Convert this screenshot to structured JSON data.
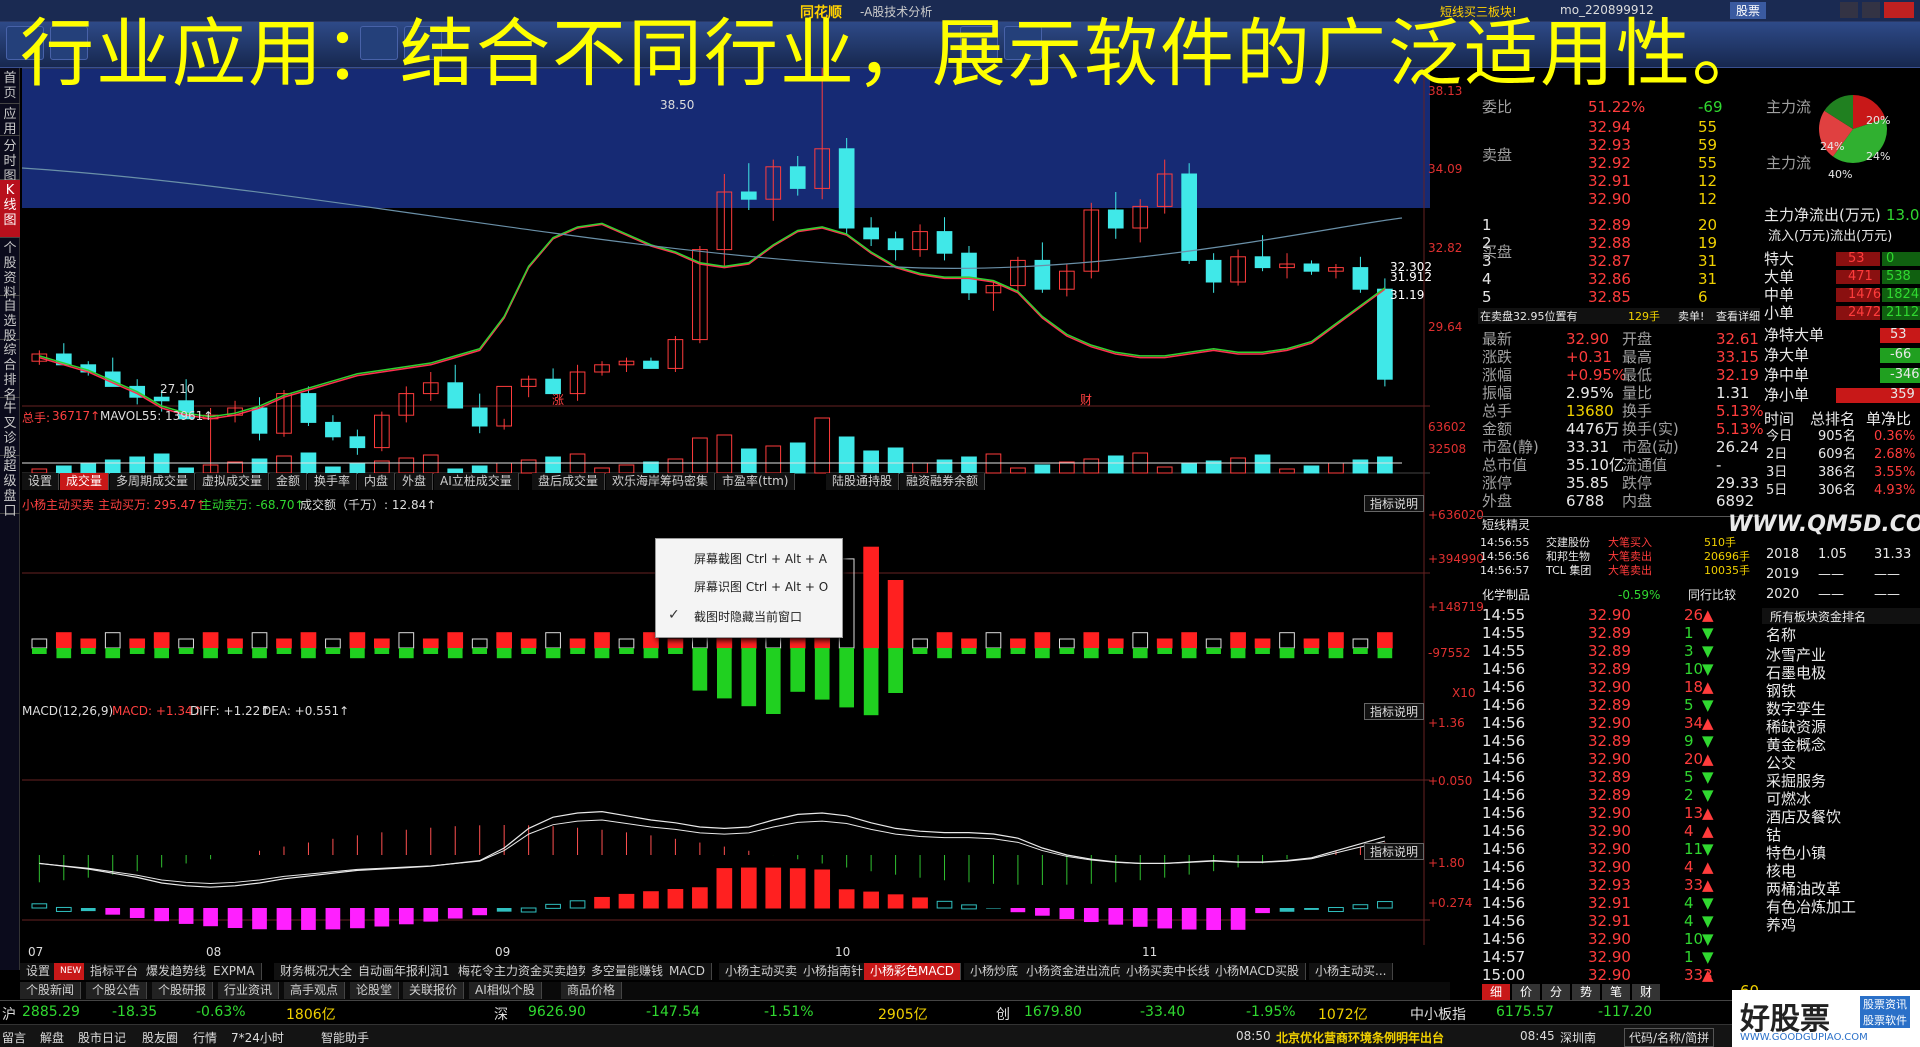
{
  "overlay": {
    "title": "行业应用：结合不同行业，展示软件的广泛适用性。"
  },
  "app": {
    "name": "同花顺",
    "subtitle": "-A股技术分析",
    "account": "mo_220899912",
    "promo": "短线买三板块!",
    "search": "股票"
  },
  "left_tabs": [
    {
      "label": "首页"
    },
    {
      "label": "应用"
    },
    {
      "label": "分时图"
    },
    {
      "label": "K线图"
    },
    {
      "label": "个股资料"
    },
    {
      "label": "自选股"
    },
    {
      "label": "综合排名"
    },
    {
      "label": "牛叉诊股"
    },
    {
      "label": "超级盘口"
    }
  ],
  "chart_data": [
    {
      "type": "candlestick",
      "title": "",
      "price_axis": {
        "ticks": [
          38.13,
          34.09,
          32.82,
          29.64
        ]
      },
      "ma_labels": [
        "32.302",
        "31.912",
        "31.19"
      ],
      "annotations": [
        "38.50",
        "27.10"
      ],
      "x_labels": [
        "07",
        "08",
        "09",
        "10",
        "11"
      ],
      "events": [
        "涨",
        "财"
      ],
      "series": [
        {
          "name": "MA",
          "values": [
            30.4,
            30.2,
            30.0,
            29.7,
            29.4,
            29.0,
            28.8,
            28.7,
            28.8,
            29.0,
            29.3,
            29.5,
            29.7,
            29.9,
            30.0,
            30.1,
            30.2,
            30.4,
            30.6,
            31.5,
            32.9,
            33.7,
            34.0,
            34.1,
            33.8,
            33.5,
            33.3,
            33.0,
            32.9,
            33.0,
            33.5,
            33.9,
            34.0,
            33.8,
            33.3,
            32.9,
            32.7,
            32.6,
            32.6,
            32.5,
            32.2,
            31.5,
            31.0,
            30.7,
            30.5,
            30.4,
            30.4,
            30.5,
            30.6,
            30.5,
            30.5,
            30.6,
            30.8,
            31.3,
            31.8,
            32.3
          ]
        }
      ],
      "candles": [
        [
          30.3,
          30.6,
          30.2,
          30.5
        ],
        [
          30.5,
          30.8,
          30.3,
          30.2
        ],
        [
          30.2,
          30.3,
          29.9,
          30.0
        ],
        [
          30.0,
          30.4,
          29.8,
          29.6
        ],
        [
          29.6,
          29.8,
          29.1,
          29.3
        ],
        [
          29.3,
          29.5,
          28.9,
          29.2
        ],
        [
          29.2,
          29.8,
          29.0,
          28.7
        ],
        [
          28.7,
          29.0,
          27.1,
          28.8
        ],
        [
          28.8,
          29.2,
          28.6,
          29.0
        ],
        [
          29.0,
          29.3,
          28.1,
          28.3
        ],
        [
          28.3,
          29.5,
          28.2,
          29.4
        ],
        [
          29.4,
          29.6,
          28.5,
          28.6
        ],
        [
          28.6,
          28.8,
          28.1,
          28.2
        ],
        [
          28.2,
          28.4,
          27.7,
          27.9
        ],
        [
          27.9,
          28.9,
          27.8,
          28.8
        ],
        [
          28.8,
          29.6,
          28.6,
          29.4
        ],
        [
          29.4,
          30.0,
          29.2,
          29.7
        ],
        [
          29.7,
          30.2,
          29.5,
          29.0
        ],
        [
          29.0,
          29.4,
          28.3,
          28.5
        ],
        [
          28.5,
          28.7,
          28.4,
          29.6
        ],
        [
          29.6,
          29.9,
          29.3,
          29.8
        ],
        [
          29.8,
          30.1,
          29.5,
          29.4
        ],
        [
          29.4,
          30.2,
          29.2,
          30.0
        ],
        [
          30.0,
          30.3,
          29.9,
          30.2
        ],
        [
          30.2,
          30.4,
          30.0,
          30.3
        ],
        [
          30.3,
          30.4,
          30.1,
          30.1
        ],
        [
          30.1,
          31.0,
          30.0,
          30.9
        ],
        [
          30.9,
          33.5,
          30.8,
          33.4
        ],
        [
          33.4,
          35.5,
          32.9,
          35.0
        ],
        [
          35.0,
          35.8,
          34.5,
          34.8
        ],
        [
          34.8,
          35.9,
          34.2,
          35.7
        ],
        [
          35.7,
          36.0,
          34.9,
          35.1
        ],
        [
          35.1,
          38.5,
          34.8,
          36.2
        ],
        [
          36.2,
          36.5,
          33.8,
          34.0
        ],
        [
          34.0,
          34.3,
          33.5,
          33.7
        ],
        [
          33.7,
          33.9,
          33.1,
          33.4
        ],
        [
          33.4,
          34.1,
          33.2,
          33.9
        ],
        [
          33.9,
          34.3,
          33.1,
          33.3
        ],
        [
          33.3,
          33.5,
          32.0,
          32.2
        ],
        [
          32.2,
          32.5,
          31.7,
          32.4
        ],
        [
          32.4,
          33.2,
          32.2,
          33.1
        ],
        [
          33.1,
          33.6,
          32.2,
          32.3
        ],
        [
          32.3,
          33.0,
          32.1,
          32.8
        ],
        [
          32.8,
          34.7,
          32.6,
          34.5
        ],
        [
          34.5,
          35.0,
          33.7,
          34.0
        ],
        [
          34.0,
          34.8,
          33.6,
          34.6
        ],
        [
          34.6,
          35.9,
          34.4,
          35.5
        ],
        [
          35.5,
          35.8,
          33.0,
          33.1
        ],
        [
          33.1,
          33.3,
          32.2,
          32.5
        ],
        [
          32.5,
          33.4,
          32.4,
          33.2
        ],
        [
          33.2,
          33.8,
          32.8,
          32.9
        ],
        [
          32.9,
          33.3,
          32.6,
          33.0
        ],
        [
          33.0,
          33.1,
          32.7,
          32.8
        ],
        [
          32.8,
          33.0,
          32.6,
          32.9
        ],
        [
          32.9,
          33.2,
          32.2,
          32.3
        ],
        [
          32.3,
          32.6,
          29.6,
          29.8
        ]
      ]
    },
    {
      "type": "bar",
      "title": "",
      "series": [
        {
          "name": "",
          "values": []
        }
      ]
    },
    {
      "type": "bar",
      "title": "",
      "price_axis": {
        "ticks": [
          "+636020",
          "+394990",
          "+148719",
          "-97552"
        ]
      },
      "scale": "X10"
    },
    {
      "type": "line",
      "title": "MACD(12,26,9)",
      "price_axis": {
        "ticks": [
          "+1.36",
          "+0.050"
        ]
      }
    },
    {
      "type": "bar",
      "title": "",
      "price_axis": {
        "ticks": [
          "+1.80",
          "+0.274"
        ]
      }
    }
  ],
  "vol": {
    "label": "总手:",
    "value": "36717↑",
    "ma": "MAVOL55: 13961↑",
    "ticks": [
      "63602",
      "32508"
    ]
  },
  "tabs1": [
    "设置",
    "成交量",
    "多周期成交量",
    "虚拟成交量",
    "金额",
    "换手率",
    "内盘",
    "外盘",
    "AI立桩成交量",
    "盘后成交量",
    "欢乐海岸筹码密集",
    "市盈率(ttm)",
    "陆股通持股",
    "融资融券余额"
  ],
  "ind1": {
    "a": "小杨主动买卖",
    "b": "主动买万: 295.47↑",
    "c": "主动卖万: -68.70↑",
    "d": "成交额（千万）: 12.84↑",
    "btn": "指标说明"
  },
  "macd": {
    "a": "MACD(12,26,9)",
    "b": "MACD: +1.34↑",
    "c": "DIFF: +1.22↑",
    "d": "DEA: +0.551↑",
    "btn": "指标说明"
  },
  "ind3": {
    "btn": "指标说明"
  },
  "menu": [
    {
      "label": "屏幕截图  Ctrl + Alt + A",
      "checked": false
    },
    {
      "label": "屏幕识图  Ctrl + Alt + O",
      "checked": false
    },
    {
      "label": "截图时隐藏当前窗口",
      "checked": true
    }
  ],
  "tabs2": [
    "设置",
    "NEW",
    "指标平台",
    "爆发趋势线",
    "EXPMA",
    "财务概况大全",
    "自动画年报利润1",
    "梅花令主力资金买卖趋势",
    "多空量能赚钱",
    "MACD",
    "小杨主动买卖",
    "小杨指南针",
    "小杨彩色MACD",
    "小杨炒底",
    "小杨资金进出流向",
    "小杨买卖中长线",
    "小杨MACD买股",
    "小杨主动买..."
  ],
  "navtabs": [
    "个股新闻",
    "个股公告",
    "个股研报",
    "行业资讯",
    "高手观点",
    "论股堂",
    "关联报价",
    "AI相似个股",
    "商品价格"
  ],
  "orderbook": {
    "header": "委比",
    "header_val": "51.22%",
    "header_n": "-69",
    "sell": [
      {
        "p": "32.94",
        "v": "55"
      },
      {
        "p": "32.93",
        "v": "59"
      },
      {
        "p": "32.92",
        "v": "55"
      },
      {
        "p": "32.91",
        "v": "12"
      },
      {
        "p": "32.90",
        "v": "12"
      }
    ],
    "buy": [
      {
        "i": "1",
        "p": "32.89",
        "v": "20"
      },
      {
        "i": "2",
        "p": "32.88",
        "v": "19"
      },
      {
        "i": "3",
        "p": "32.87",
        "v": "31"
      },
      {
        "i": "4",
        "p": "32.86",
        "v": "31"
      },
      {
        "i": "5",
        "p": "32.85",
        "v": "6"
      }
    ],
    "sell_lbl": "卖盘",
    "buy_lbl": "买盘"
  },
  "pending": {
    "a": "在卖盘32.95位置有",
    "b": "129手",
    "c": "卖单!",
    "d": "查看详细"
  },
  "quote": [
    [
      "最新",
      "32.90",
      "开盘",
      "32.61"
    ],
    [
      "涨跌",
      "+0.31",
      "最高",
      "33.15"
    ],
    [
      "涨幅",
      "+0.95%",
      "最低",
      "32.19"
    ],
    [
      "振幅",
      "2.95%",
      "量比",
      "1.31"
    ],
    [
      "总手",
      "13680",
      "换手",
      "5.13%"
    ],
    [
      "金额",
      "4476万",
      "换手(实)",
      "5.13%"
    ],
    [
      "市盈(静)",
      "33.31",
      "市盈(动)",
      "26.24"
    ],
    [
      "总市值",
      "35.10亿",
      "流通值",
      "-"
    ],
    [
      "涨停",
      "35.85",
      "跌停",
      "29.33"
    ],
    [
      "外盘",
      "6788",
      "内盘",
      "6892"
    ]
  ],
  "shortline": {
    "title": "短线精灵",
    "rows": [
      [
        "14:56:55",
        "交建股份",
        "大笔买入",
        "510手"
      ],
      [
        "14:56:56",
        "和邦生物",
        "大笔卖出",
        "20696手"
      ],
      [
        "14:56:57",
        "TCL 集团",
        "大笔卖出",
        "10035手"
      ]
    ]
  },
  "sector": {
    "name": "化学制品",
    "chg": "-0.59%",
    "btn": "同行比较"
  },
  "ticks": [
    [
      "14:55",
      "32.90",
      "26",
      "▲"
    ],
    [
      "14:55",
      "32.89",
      "1",
      "▼"
    ],
    [
      "14:55",
      "32.89",
      "3",
      "▼"
    ],
    [
      "14:56",
      "32.89",
      "10",
      "▼"
    ],
    [
      "14:56",
      "32.90",
      "18",
      "▲"
    ],
    [
      "14:56",
      "32.89",
      "5",
      "▼"
    ],
    [
      "14:56",
      "32.90",
      "34",
      "▲"
    ],
    [
      "14:56",
      "32.89",
      "9",
      "▼"
    ],
    [
      "14:56",
      "32.90",
      "20",
      "▲"
    ],
    [
      "14:56",
      "32.89",
      "5",
      "▼"
    ],
    [
      "14:56",
      "32.89",
      "2",
      "▼"
    ],
    [
      "14:56",
      "32.90",
      "13",
      "▲"
    ],
    [
      "14:56",
      "32.90",
      "4",
      "▲"
    ],
    [
      "14:56",
      "32.90",
      "11",
      "▼"
    ],
    [
      "14:56",
      "32.90",
      "4",
      "▲"
    ],
    [
      "14:56",
      "32.93",
      "33",
      "▲"
    ],
    [
      "14:56",
      "32.91",
      "4",
      "▼"
    ],
    [
      "14:56",
      "32.91",
      "4",
      "▼"
    ],
    [
      "14:56",
      "32.90",
      "10",
      "▼"
    ],
    [
      "14:57",
      "32.90",
      "1",
      "▼"
    ],
    [
      "15:00",
      "32.90",
      "333",
      "▲"
    ]
  ],
  "ticks_last_extra": "60",
  "far": {
    "pie": {
      "a": "主力流",
      "b": "主力流",
      "c": "20%",
      "d": "40%",
      "e": "24%",
      "f": "24%"
    },
    "flow_title": "主力净流出(万元)",
    "flow_val": "13.0",
    "flow_hdr": "流入(万元)流出(万元)",
    "rows": [
      [
        "特大",
        "53",
        "0"
      ],
      [
        "大单",
        "471",
        "538"
      ],
      [
        "中单",
        "1476",
        "1824"
      ],
      [
        "小单",
        "2472",
        "2112"
      ]
    ],
    "net": [
      [
        "净特大单",
        "53"
      ],
      [
        "净大单",
        "-66"
      ],
      [
        "净中单",
        "-346"
      ],
      [
        "净小单",
        "359"
      ]
    ],
    "rank_hdr": [
      "时间",
      "总排名",
      "单净比"
    ],
    "ranks": [
      [
        "今日",
        "905名",
        "0.36%"
      ],
      [
        "2日",
        "609名",
        "2.68%"
      ],
      [
        "3日",
        "386名",
        "3.55%"
      ],
      [
        "5日",
        "306名",
        "4.93%"
      ]
    ],
    "watermark": "WWW.QM5D.COM",
    "years": [
      [
        "2018",
        "1.05",
        "31.33"
      ],
      [
        "2019",
        "——",
        "——"
      ],
      [
        "2020",
        "——",
        "——"
      ]
    ],
    "sector_title": "所有板块资金排名",
    "sector_hdr": "名称",
    "sectors": [
      "冰雪产业",
      "石墨电极",
      "钢铁",
      "数字孪生",
      "稀缺资源",
      "黄金概念",
      "公交",
      "采掘服务",
      "可燃冰",
      "酒店及餐饮",
      "钴",
      "特色小镇",
      "核电",
      "两桶油改革",
      "有色冶炼加工",
      "养鸡"
    ]
  },
  "bottomtabs": [
    "细",
    "价",
    "分",
    "势",
    "笔",
    "财"
  ],
  "index": [
    {
      "n": "沪",
      "v": "2885.29",
      "c": "-18.35",
      "p": "-0.63%",
      "a": "1806亿"
    },
    {
      "n": "深",
      "v": "9626.90",
      "c": "-147.54",
      "p": "-1.51%",
      "a": "2905亿"
    },
    {
      "n": "创",
      "v": "1679.80",
      "c": "-33.40",
      "p": "-1.95%",
      "a": "1072亿"
    },
    {
      "n": "中小板指",
      "v": "6175.57",
      "c": "-117.20",
      "p": "",
      "a": ""
    }
  ],
  "status": {
    "items": [
      "留言",
      "解盘",
      "股市日记",
      "股友圈",
      "行情",
      "7*24小时",
      "智能助手"
    ],
    "time": "08:50",
    "news": "北京优化营商环境条例明年出台",
    "time2": "08:45",
    "place": "深圳南",
    "code": "代码/名称/简拼"
  },
  "logo": {
    "name": "好股票",
    "tag1": "股票资讯",
    "tag2": "股票软件",
    "url": "WWW.GOODGUPIAO.COM"
  }
}
